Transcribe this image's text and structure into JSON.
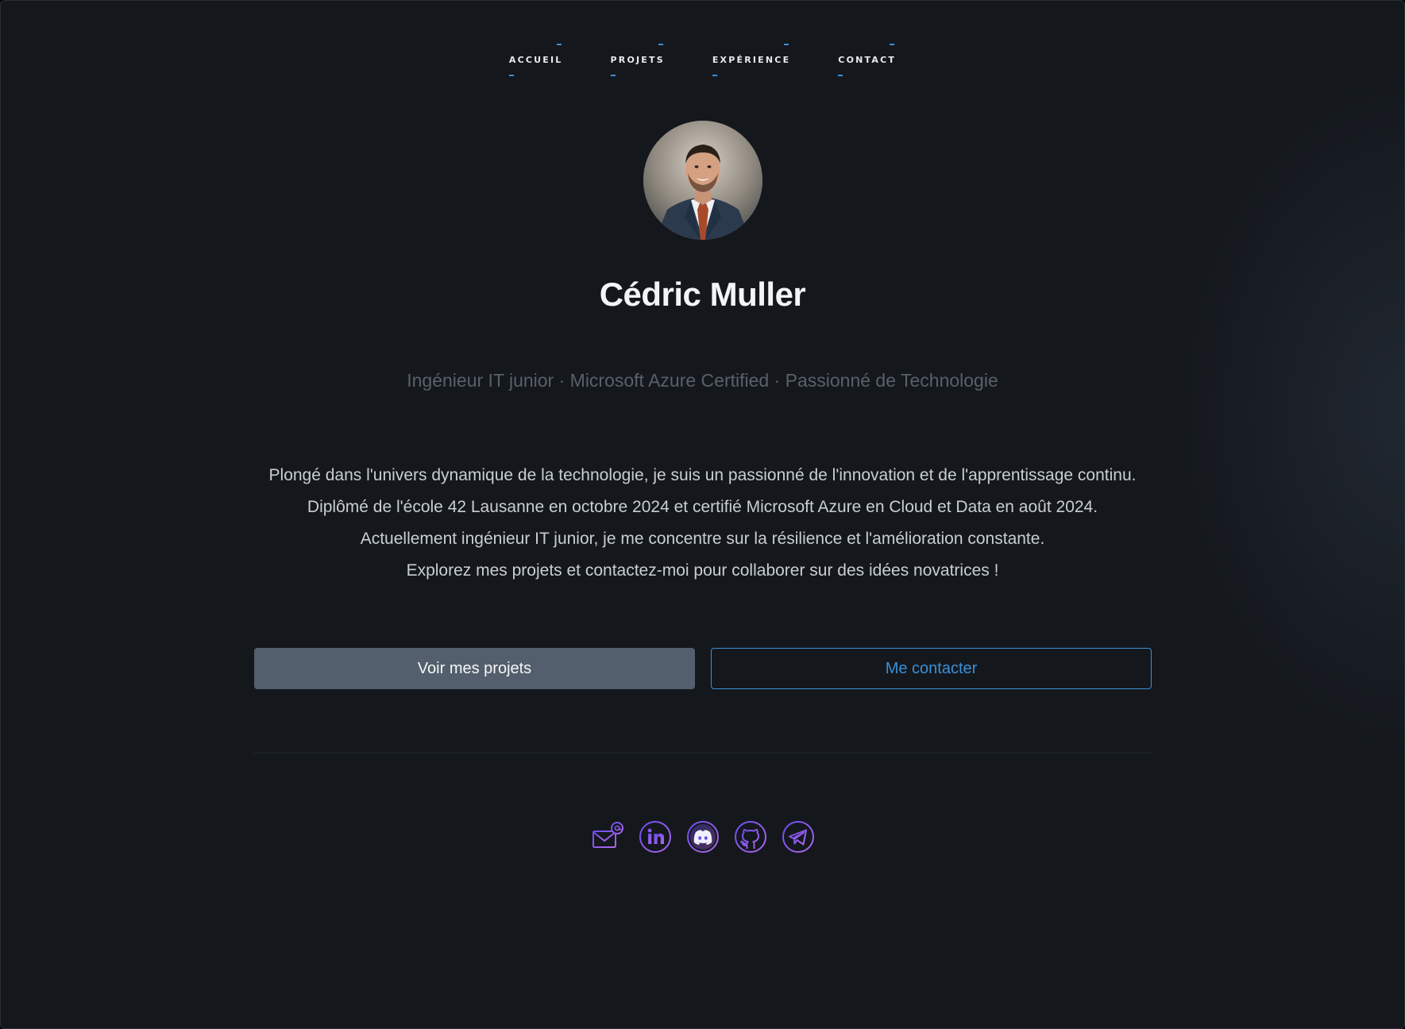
{
  "nav": {
    "items": [
      {
        "label": "ACCUEIL"
      },
      {
        "label": "PROJETS"
      },
      {
        "label": "EXPÉRIENCE"
      },
      {
        "label": "CONTACT"
      }
    ]
  },
  "profile": {
    "name": "Cédric Muller",
    "subtitle": "Ingénieur IT junior · Microsoft Azure Certified · Passionné de Technologie",
    "bio": [
      "Plongé dans l'univers dynamique de la technologie, je suis un passionné de l'innovation et de l'apprentissage continu.",
      "Diplômé de l'école 42 Lausanne en octobre 2024 et certifié Microsoft Azure en Cloud et Data en août 2024.",
      "Actuellement ingénieur IT junior, je me concentre sur la résilience et l'amélioration constante.",
      "Explorez mes projets et contactez-moi pour collaborer sur des idées novatrices !"
    ]
  },
  "buttons": {
    "projects_label": "Voir mes projets",
    "contact_label": "Me contacter"
  },
  "social": {
    "icons": [
      "email-icon",
      "linkedin-icon",
      "discord-icon",
      "github-icon",
      "telegram-icon"
    ]
  },
  "colors": {
    "background": "#14181d",
    "accent": "#3b8fd6",
    "icon_gradient_start": "#6a4cf0",
    "icon_gradient_end": "#b066e8",
    "primary_button": "#535f6c"
  }
}
